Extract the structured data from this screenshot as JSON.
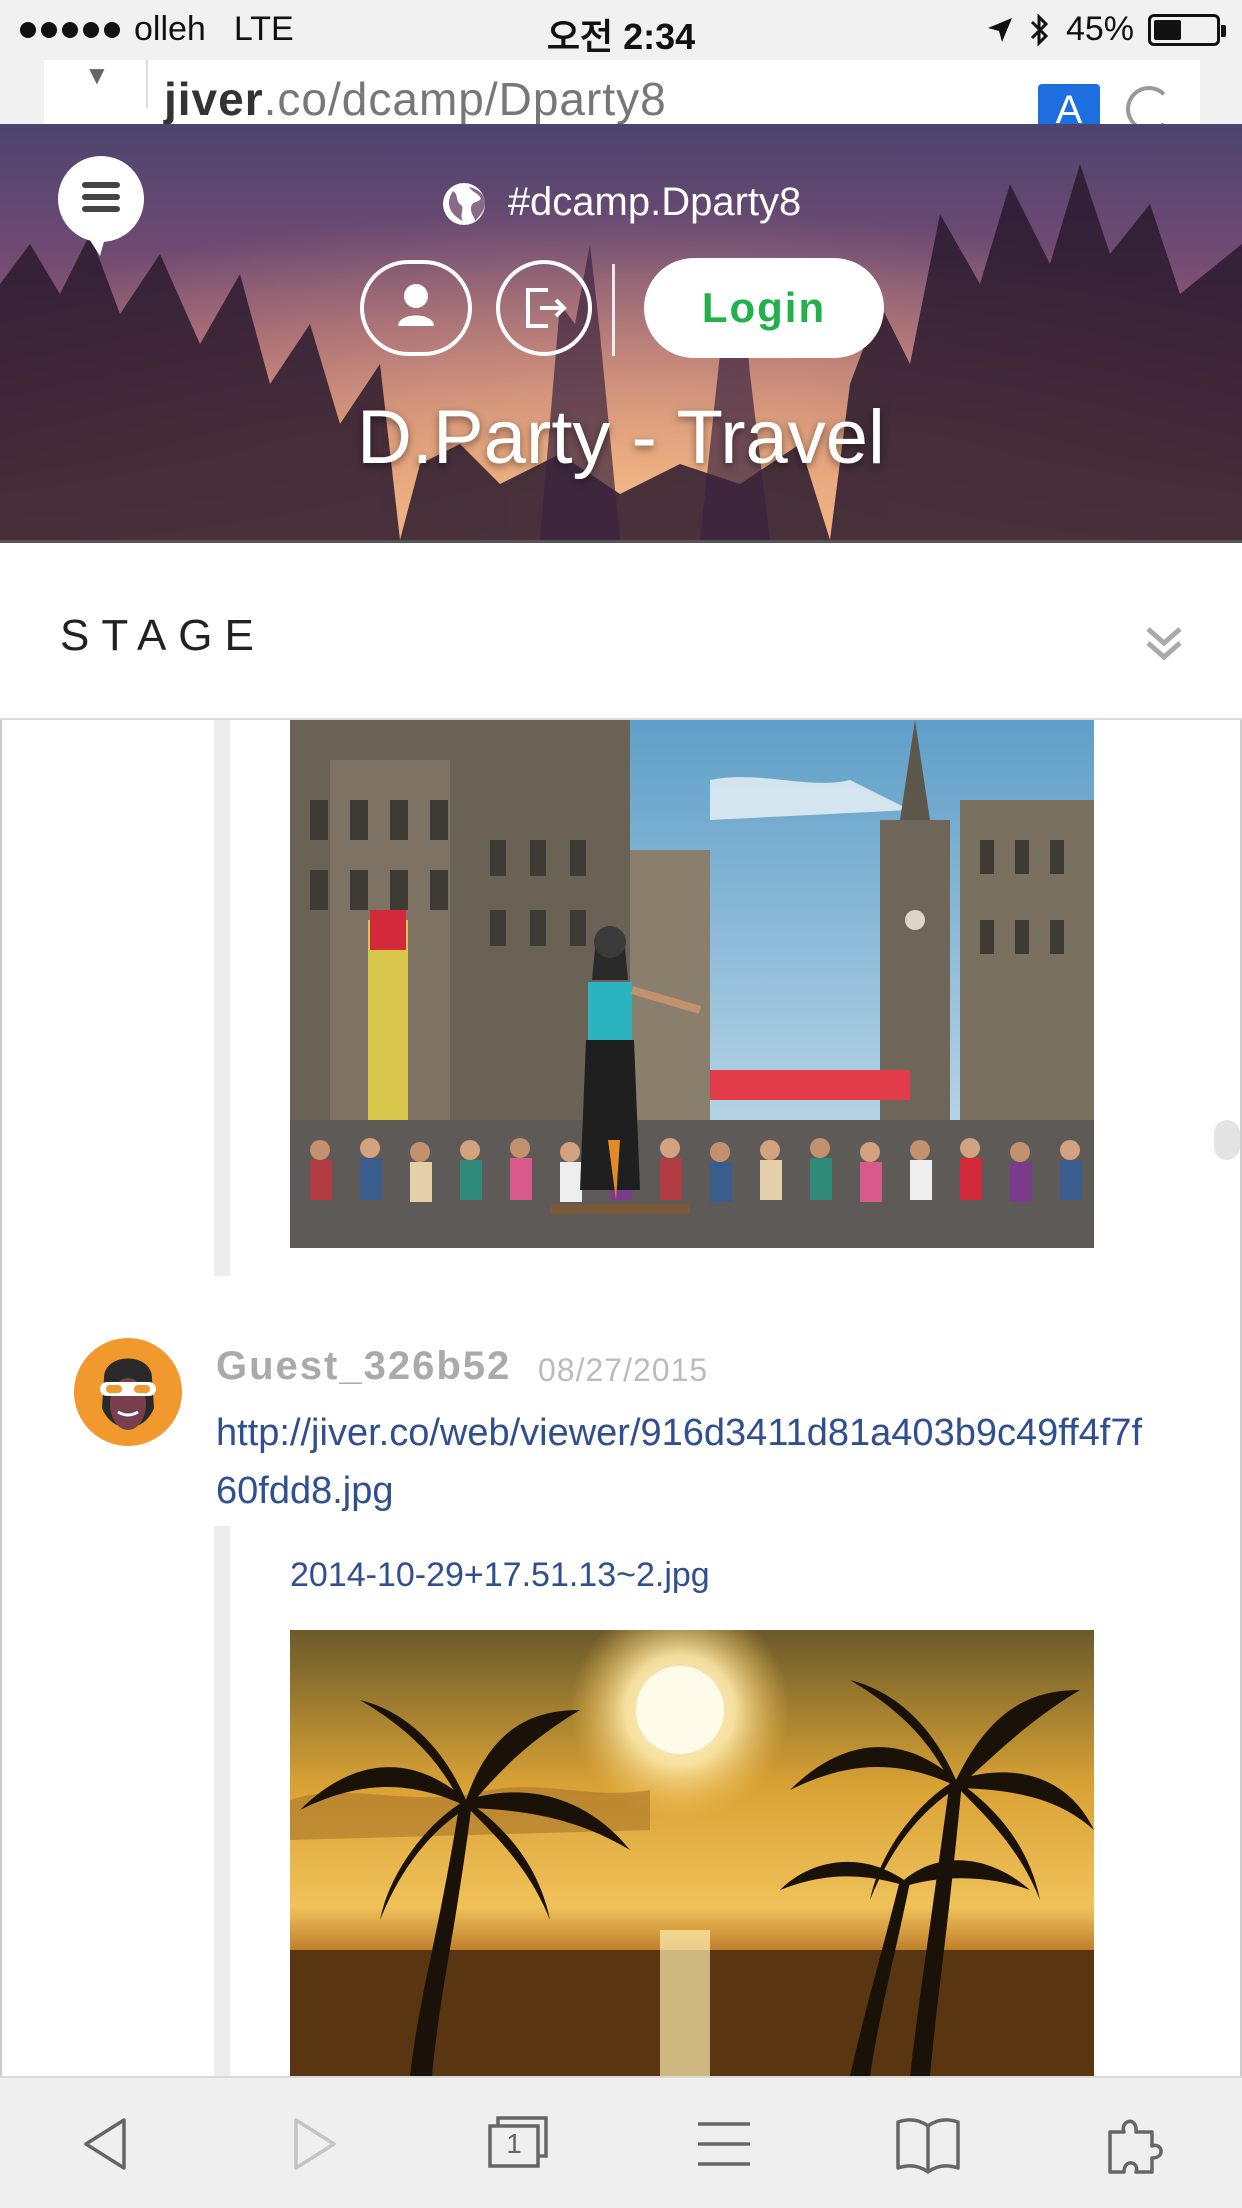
{
  "status_bar": {
    "carrier": "olleh",
    "network": "LTE",
    "time": "오전 2:34",
    "battery_label": "45%",
    "battery_level": 0.45,
    "icons": [
      "signal-dots-icon",
      "location-arrow-icon",
      "bluetooth-icon",
      "battery-icon"
    ]
  },
  "browser": {
    "url_domain": "jiver",
    "url_path": ".co/dcamp/Dparty8",
    "translate_label": "A"
  },
  "header": {
    "room_tag": "#dcamp.Dparty8",
    "login_label": "Login",
    "title": "D.Party - Travel",
    "icons": [
      "menu-icon",
      "globe-icon",
      "profile-icon",
      "logout-icon"
    ]
  },
  "stage": {
    "title": "STAGE",
    "toggle_icon": "double-chevron-down-icon"
  },
  "posts": [
    {
      "user": "Guest_326b52",
      "date": "08/27/2015",
      "link": "http://jiver.co/web/viewer/916d3411d81a403b9c49ff4f7f60fdd8.jpg",
      "attachment_name": "2014-10-29+17.51.13~2.jpg"
    }
  ],
  "toolbar": {
    "icons": [
      "back-icon",
      "forward-icon",
      "tabs-icon",
      "menu-icon",
      "bookmarks-icon",
      "extensions-icon"
    ],
    "tab_count": "1"
  },
  "colors": {
    "login_text": "#22b04b",
    "link": "#2f4f8f",
    "avatar_bg": "#f2992e",
    "translate_bg": "#1d6fe0"
  }
}
